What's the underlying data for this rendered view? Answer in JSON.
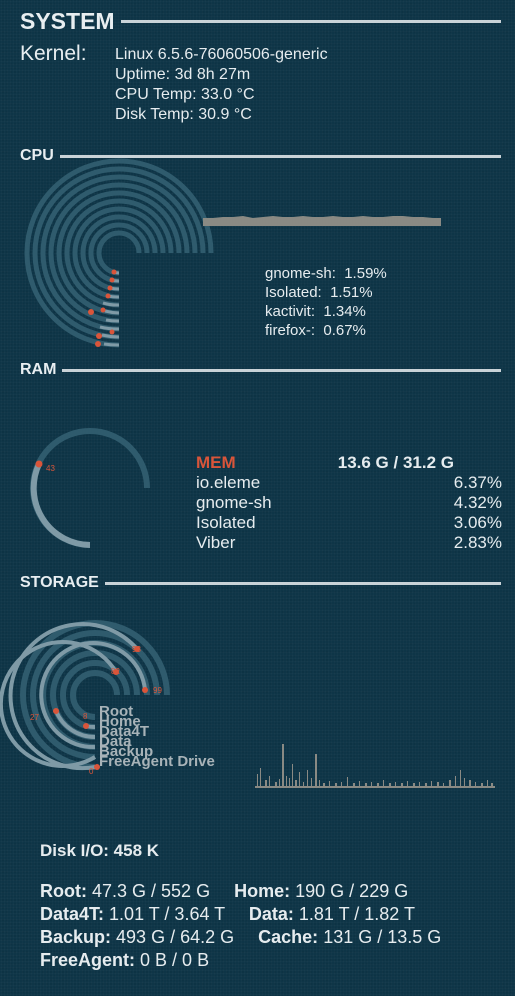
{
  "system": {
    "header": "SYSTEM",
    "kernel_label": "Kernel:",
    "kernel": "Linux 6.5.6-76060506-generic",
    "uptime": "Uptime: 3d 8h 27m",
    "cpu_temp": "CPU Temp: 33.0 °C",
    "disk_temp": "Disk Temp: 30.9 °C"
  },
  "cpu": {
    "header": "CPU",
    "processes": [
      {
        "name": "gnome-sh:",
        "value": "1.59%"
      },
      {
        "name": "Isolated:",
        "value": "1.51%"
      },
      {
        "name": "kactivit:",
        "value": "1.34%"
      },
      {
        "name": "firefox-:",
        "value": "0.67%"
      }
    ]
  },
  "ram": {
    "header": "RAM",
    "gauge_label": "43",
    "mem_label": "MEM",
    "mem_value": "13.6 G / 31.2 G",
    "processes": [
      {
        "name": "io.eleme",
        "value": "6.37%"
      },
      {
        "name": "gnome-sh",
        "value": "4.32%"
      },
      {
        "name": "Isolated",
        "value": "3.06%"
      },
      {
        "name": "Viber",
        "value": "2.83%"
      }
    ]
  },
  "storage": {
    "header": "STORAGE",
    "ring_labels": [
      "Root",
      "Home",
      "Data4T",
      "Data",
      "Backup",
      "FreeAgent Drive"
    ],
    "gauge_values": [
      "93",
      "82",
      "99",
      "27",
      "8",
      "0"
    ],
    "disk_io": "Disk I/O: 458 K",
    "usage": {
      "root_label": "Root:",
      "root": "47.3 G / 552 G",
      "home_label": "Home:",
      "home": "190 G / 229 G",
      "data4t_label": "Data4T:",
      "data4t": "1.01 T / 3.64 T",
      "data_label": "Data:",
      "data": "1.81 T / 1.82 T",
      "backup_label": "Backup:",
      "backup": "493 G / 64.2 G",
      "cache_label": "Cache:",
      "cache": "131 G / 13.5 G",
      "freeagent_label": "FreeAgent:",
      "freeagent": "0 B / 0 B"
    }
  },
  "colors": {
    "background": "#0e3547",
    "accent": "#d9553a",
    "ring": "#2f5b6d",
    "ring_bright": "#7f9aa6",
    "text": "#e6ecef",
    "graph": "#8a8a84"
  }
}
